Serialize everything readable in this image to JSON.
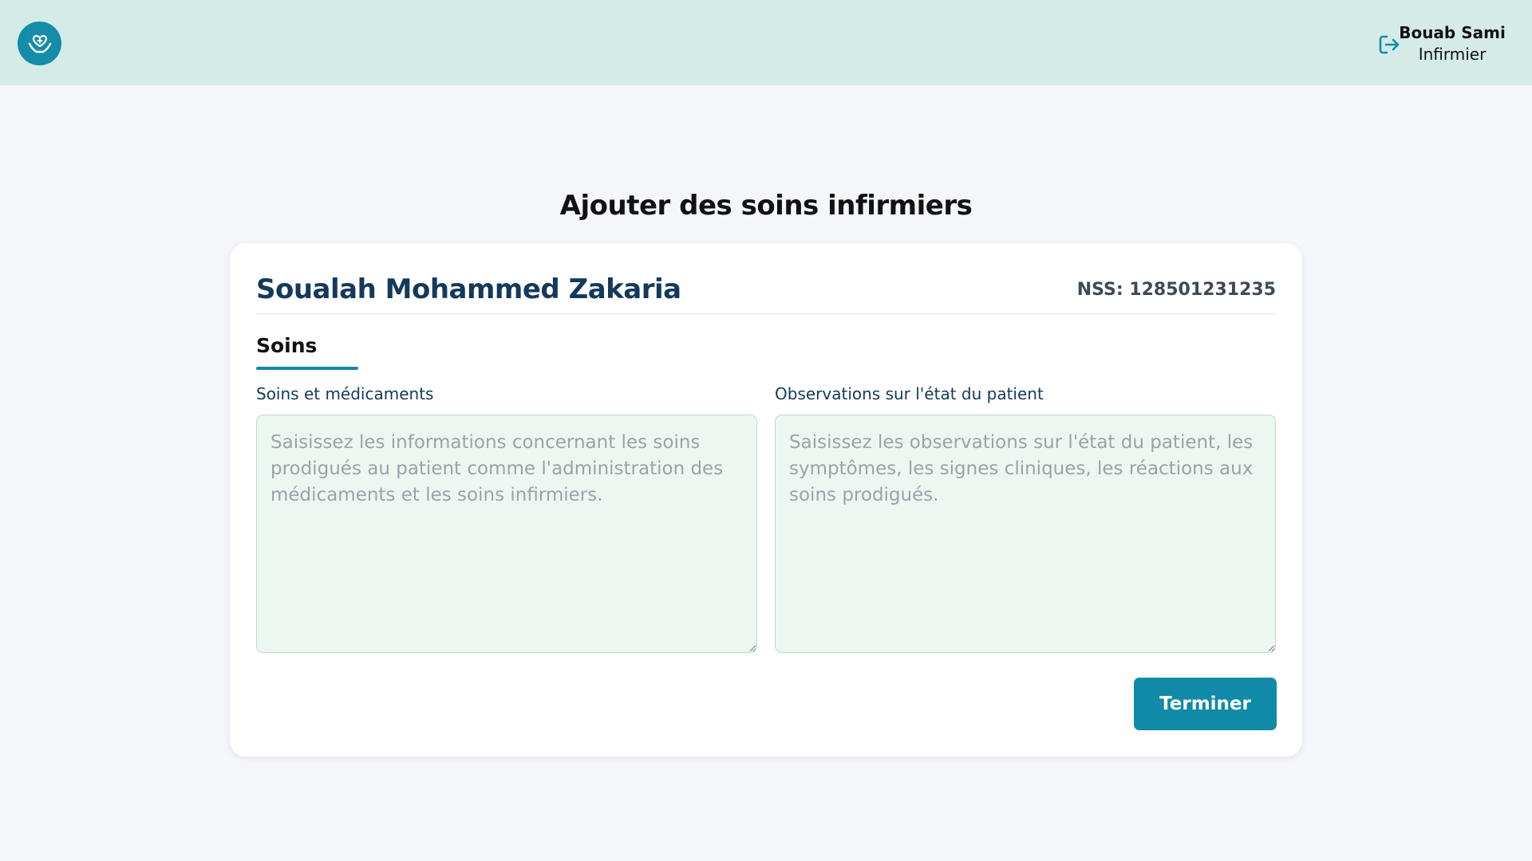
{
  "header": {
    "logo_icon": "heart-hands-icon",
    "logout_icon": "logout-icon",
    "user_name": "Bouab Sami",
    "user_role": "Infirmier",
    "brand_color": "#158ca8",
    "bar_color": "#d4ebe7"
  },
  "page": {
    "title": "Ajouter des soins infirmiers"
  },
  "patient": {
    "name": "Soualah Mohammed Zakaria",
    "nss": "NSS: 128501231235"
  },
  "tabs": [
    {
      "label": "Soins",
      "active": true
    }
  ],
  "form": {
    "care_label": "Soins et médicaments",
    "care_value": "",
    "care_placeholder": "Saisissez les informations concernant les soins prodigués au patient comme l'administration des médicaments et les soins infirmiers.",
    "obs_label": "Observations sur l'état du patient",
    "obs_value": "",
    "obs_placeholder": "Saisissez les observations sur l'état du patient, les symptômes, les signes cliniques, les réactions aux soins prodigués.",
    "submit_label": "Terminer"
  }
}
